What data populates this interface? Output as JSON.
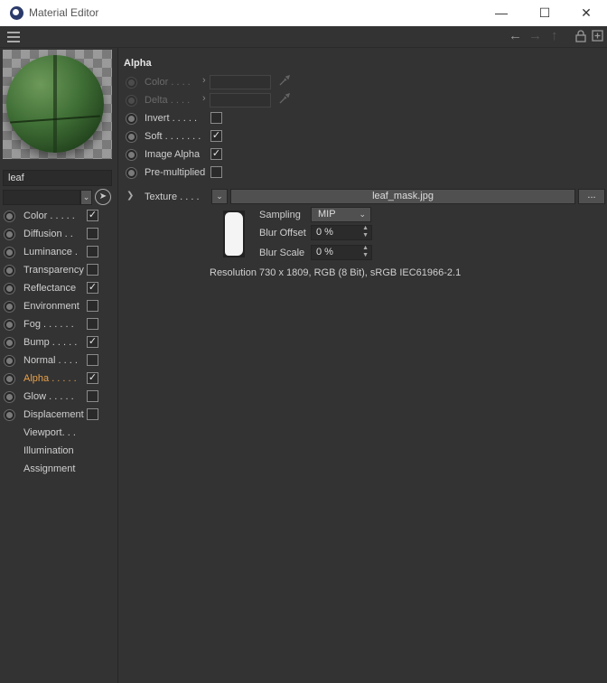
{
  "window": {
    "title": "Material Editor",
    "controls": {
      "minimize": "—",
      "maximize": "☐",
      "close": "✕"
    }
  },
  "toolbar": {
    "icons": [
      "hamburger-menu-icon",
      "back-arrow-icon",
      "forward-arrow-icon",
      "up-arrow-icon",
      "lock-icon",
      "new-window-icon"
    ]
  },
  "material": {
    "name": "leaf",
    "layer_value": ""
  },
  "channels": [
    {
      "label": "Color . . . . .",
      "has_radio": true,
      "checked": true,
      "active": false
    },
    {
      "label": "Diffusion . .",
      "has_radio": true,
      "checked": false,
      "active": false
    },
    {
      "label": "Luminance  .",
      "has_radio": true,
      "checked": false,
      "active": false
    },
    {
      "label": "Transparency",
      "has_radio": true,
      "checked": false,
      "active": false
    },
    {
      "label": "Reflectance",
      "has_radio": true,
      "checked": true,
      "active": false
    },
    {
      "label": "Environment",
      "has_radio": true,
      "checked": false,
      "active": false
    },
    {
      "label": "Fog  . . . . . .",
      "has_radio": true,
      "checked": false,
      "active": false
    },
    {
      "label": "Bump . . . . .",
      "has_radio": true,
      "checked": true,
      "active": false
    },
    {
      "label": "Normal . . . .",
      "has_radio": true,
      "checked": false,
      "active": false
    },
    {
      "label": "Alpha . . . . .",
      "has_radio": true,
      "checked": true,
      "active": true
    },
    {
      "label": "Glow  . . . . .",
      "has_radio": true,
      "checked": false,
      "active": false
    },
    {
      "label": "Displacement",
      "has_radio": true,
      "checked": false,
      "active": false
    },
    {
      "label": "Viewport. . .",
      "has_radio": false,
      "checked": null,
      "active": false
    },
    {
      "label": "Illumination",
      "has_radio": false,
      "checked": null,
      "active": false
    },
    {
      "label": "Assignment",
      "has_radio": false,
      "checked": null,
      "active": false
    }
  ],
  "alpha": {
    "section_title": "Alpha",
    "color_label": "Color  . . . .",
    "delta_label": "Delta  . . . .",
    "invert_label": "Invert . . . . .",
    "invert_checked": false,
    "soft_label": "Soft  . . . . . . .",
    "soft_checked": true,
    "image_alpha_label": "Image Alpha",
    "image_alpha_checked": true,
    "premultiplied_label": "Pre-multiplied",
    "premultiplied_checked": false,
    "texture_label": "Texture  . . . .",
    "texture_file": "leaf_mask.jpg",
    "texture_more": "...",
    "sampling_label": "Sampling",
    "sampling_value": "MIP",
    "blur_offset_label": "Blur Offset",
    "blur_offset_value": "0 %",
    "blur_scale_label": "Blur Scale",
    "blur_scale_value": "0 %",
    "resolution": "Resolution 730 x 1809, RGB (8 Bit), sRGB IEC61966-2.1"
  },
  "colors": {
    "background": "#333333",
    "active_channel": "#e8a04a",
    "text": "#cfcfcf",
    "disabled_text": "#6a6a6a"
  }
}
